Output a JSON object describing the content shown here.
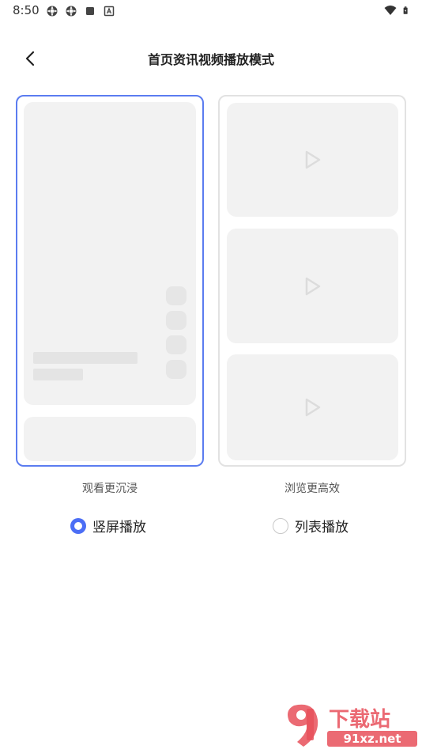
{
  "status_bar": {
    "time": "8:50",
    "left_icons": [
      "settings-gear-icon",
      "settings-gear-icon",
      "square-notification-icon",
      "a-letter-icon"
    ],
    "right_icons": [
      "wifi-icon",
      "battery-icon"
    ]
  },
  "header": {
    "title": "首页资讯视频播放模式",
    "back_icon": "chevron-left-icon"
  },
  "options": [
    {
      "id": "vertical",
      "caption": "观看更沉浸",
      "label": "竖屏播放",
      "selected": true
    },
    {
      "id": "list",
      "caption": "浏览更高效",
      "label": "列表播放",
      "selected": false
    }
  ],
  "colors": {
    "accent": "#4c6ef5",
    "selected_border": "#5b7cf0",
    "placeholder": "#f2f2f2"
  },
  "watermark": {
    "text": "下载站",
    "domain": "91xz.net"
  }
}
